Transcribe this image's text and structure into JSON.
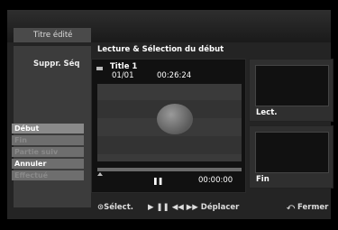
{
  "header": {
    "title": "Titre édité"
  },
  "left_panel": {
    "label": "Suppr. Séq",
    "menu": [
      {
        "label": "Début",
        "state": "selected"
      },
      {
        "label": "Fin",
        "state": "disabled"
      },
      {
        "label": "Partie suiv",
        "state": "disabled"
      },
      {
        "label": "Annuler",
        "state": "normal"
      },
      {
        "label": "Effectué",
        "state": "disabled"
      }
    ]
  },
  "main": {
    "section_title": "Lecture & Sélection du début",
    "info": {
      "title": "Title 1",
      "chapter": "01/01",
      "time": "00:26:24"
    },
    "playback": {
      "pause_icon": "❚❚",
      "counter": "00:00:00"
    }
  },
  "thumbnails": {
    "start_label": "Lect.",
    "end_label": "Fin"
  },
  "footer": {
    "select": "⊙Sélect.",
    "move": "▶ ❚❚ ◀◀ ▶▶ Déplacer",
    "close": "⤺ Fermer"
  }
}
